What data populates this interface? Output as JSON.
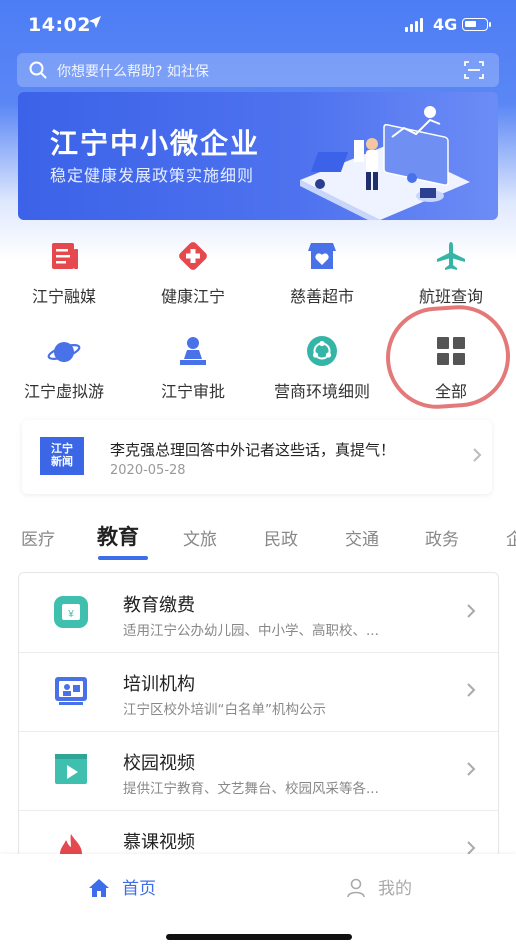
{
  "status_bar": {
    "time": "14:02",
    "network": "4G"
  },
  "search": {
    "placeholder": "你想要什么帮助?  如社保"
  },
  "banner": {
    "title": "江宁中小微企业",
    "subtitle": "稳定健康发展政策实施细则"
  },
  "quick_services": [
    {
      "label": "江宁融媒",
      "icon": "newspaper-icon",
      "color": "#e5484d"
    },
    {
      "label": "健康江宁",
      "icon": "medical-cross-icon",
      "color": "#e5484d"
    },
    {
      "label": "慈善超市",
      "icon": "charity-store-icon",
      "color": "#4a72e8"
    },
    {
      "label": "航班查询",
      "icon": "airplane-icon",
      "color": "#35b5a6"
    },
    {
      "label": "江宁虚拟游",
      "icon": "planet-icon",
      "color": "#4a72e8"
    },
    {
      "label": "江宁审批",
      "icon": "approval-stamp-icon",
      "color": "#4a72e8"
    },
    {
      "label": "营商环境细则",
      "icon": "cycle-icon",
      "color": "#35b5a6"
    },
    {
      "label": "全部",
      "icon": "grid-icon",
      "color": "#555555"
    }
  ],
  "news": {
    "logo_text": [
      "江宁",
      "新闻"
    ],
    "title": "李克强总理回答中外记者这些话，真提气！",
    "date": "2020-05-28"
  },
  "categories": {
    "tabs": [
      "医疗",
      "教育",
      "文旅",
      "民政",
      "交通",
      "政务",
      "企"
    ],
    "active": "教育"
  },
  "services": [
    {
      "title": "教育缴费",
      "subtitle": "适用江宁公办幼儿园、中小学、高职校、...",
      "icon": "tuition-payment-icon"
    },
    {
      "title": "培训机构",
      "subtitle": "江宁区校外培训“白名单”机构公示",
      "icon": "training-institution-icon"
    },
    {
      "title": "校园视频",
      "subtitle": "提供江宁教育、文艺舞台、校园风采等各...",
      "icon": "video-play-icon"
    },
    {
      "title": "慕课视频",
      "subtitle": "",
      "icon": "flame-icon"
    }
  ],
  "bottom_nav": {
    "home": "首页",
    "me": "我的"
  },
  "colors": {
    "accent": "#3d6de8",
    "header": "#4d7df5",
    "annotation": "#e06a6a"
  }
}
